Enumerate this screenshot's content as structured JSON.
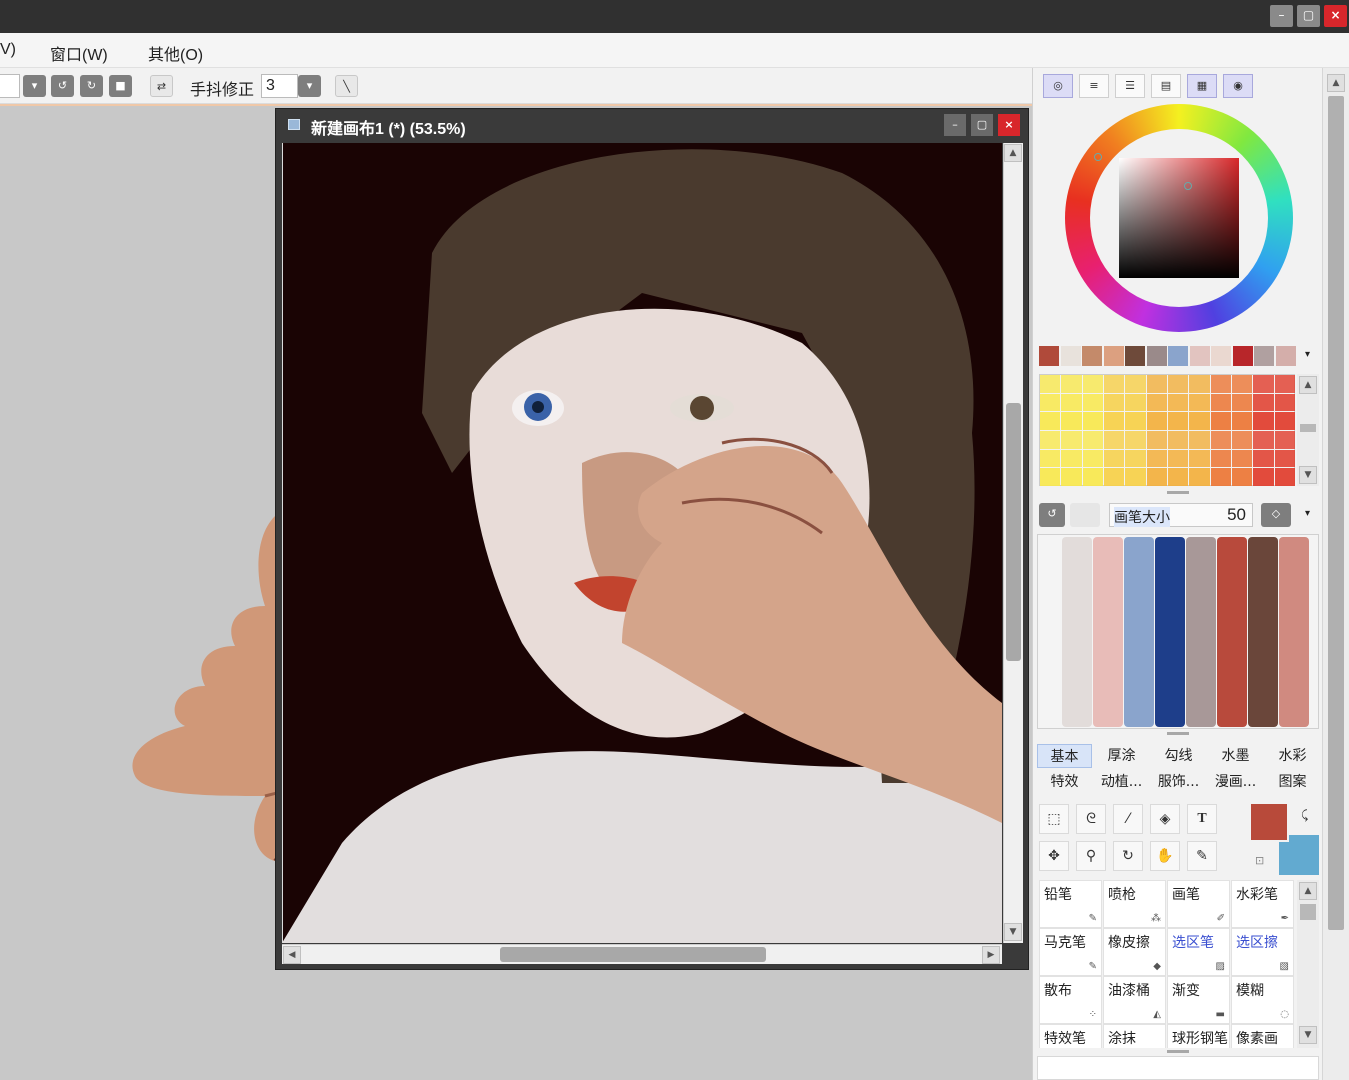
{
  "titlebar": {
    "minimize": "–",
    "restore": "▢",
    "close": "×"
  },
  "menu": {
    "partial_item": "V)",
    "window": "窗口(W)",
    "other": "其他(O)"
  },
  "toolbar": {
    "stabilizer_label": "手抖修正",
    "stabilizer_value": "3"
  },
  "canvas_window": {
    "title": "新建画布1 (*) (53.5%)"
  },
  "palette": {
    "swatches": [
      "#b04a3a",
      "#e8e2dc",
      "#c48a6a",
      "#dca080",
      "#6e4a3a",
      "#9a8a8a",
      "#8aa4cc",
      "#e2c4c0",
      "#ead8d0",
      "#b8262a",
      "#b0a0a0",
      "#d4aeaa"
    ],
    "grid_colors": [
      "#f8e850",
      "#f6d04a",
      "#f2b040",
      "#ec7838",
      "#e04030"
    ]
  },
  "brush_size": {
    "label": "画笔大小",
    "value": "50"
  },
  "mix_strokes": [
    "#e2dcda",
    "#e8bcb8",
    "#8aa4cc",
    "#1e3e8a",
    "#a89898",
    "#b84a3c",
    "#6a463a",
    "#d08a80"
  ],
  "brush_categories": {
    "row1": [
      "基本",
      "厚涂",
      "勾线",
      "水墨",
      "水彩"
    ],
    "row2": [
      "特效",
      "动植...",
      "服饰...",
      "漫画...",
      "图案"
    ]
  },
  "colors": {
    "primary": "#b84a3a",
    "secondary": "#62aad0",
    "accent": "#d8262b"
  },
  "tools": [
    {
      "label": "铅笔",
      "blue": false
    },
    {
      "label": "喷枪",
      "blue": false
    },
    {
      "label": "画笔",
      "blue": false
    },
    {
      "label": "水彩笔",
      "blue": false
    },
    {
      "label": "马克笔",
      "blue": false
    },
    {
      "label": "橡皮擦",
      "blue": false
    },
    {
      "label": "选区笔",
      "blue": true
    },
    {
      "label": "选区擦",
      "blue": true
    },
    {
      "label": "散布",
      "blue": false
    },
    {
      "label": "油漆桶",
      "blue": false
    },
    {
      "label": "渐变",
      "blue": false
    },
    {
      "label": "模糊",
      "blue": false
    },
    {
      "label": "特效笔",
      "blue": false
    },
    {
      "label": "涂抹",
      "blue": false
    },
    {
      "label": "球形钢笔",
      "blue": false
    },
    {
      "label": "像素画",
      "blue": false
    }
  ]
}
